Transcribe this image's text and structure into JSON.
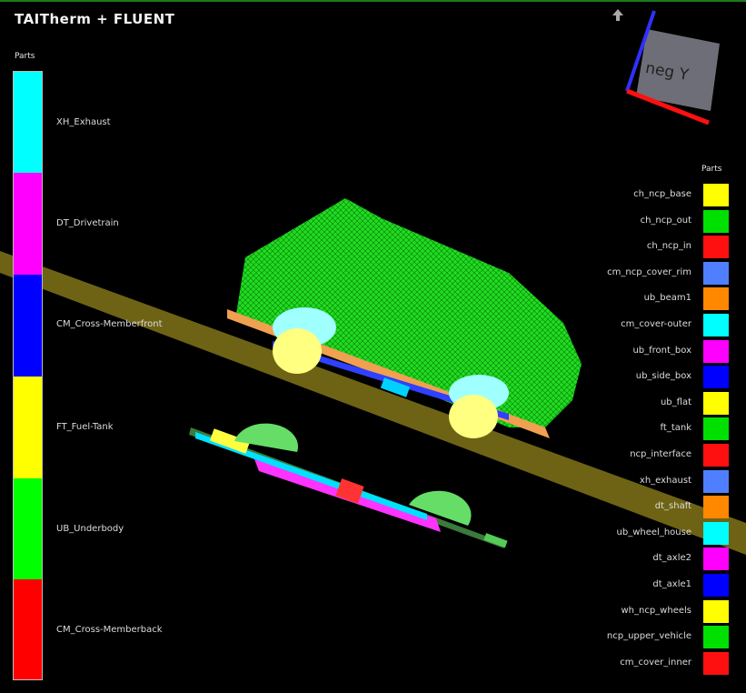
{
  "window": {
    "title": "TAITherm + FLUENT"
  },
  "left_legend": {
    "title": "Parts",
    "items": [
      {
        "label": "XH_Exhaust",
        "color": "#00ffff"
      },
      {
        "label": "DT_Drivetrain",
        "color": "#ff00ff"
      },
      {
        "label": "CM_Cross-Memberfront",
        "color": "#0000ff"
      },
      {
        "label": "FT_Fuel-Tank",
        "color": "#ffff00"
      },
      {
        "label": "UB_Underbody",
        "color": "#00ff00"
      },
      {
        "label": "CM_Cross-Memberback",
        "color": "#ff0000"
      }
    ]
  },
  "right_legend": {
    "title": "Parts",
    "items": [
      {
        "label": "ch_ncp_base",
        "color": "#ffff00"
      },
      {
        "label": "ch_ncp_out",
        "color": "#00e000"
      },
      {
        "label": "ch_ncp_in",
        "color": "#ff1010"
      },
      {
        "label": "cm_ncp_cover_rim",
        "color": "#4f7fff"
      },
      {
        "label": "ub_beam1",
        "color": "#ff8800"
      },
      {
        "label": "cm_cover-outer",
        "color": "#00ffff"
      },
      {
        "label": "ub_front_box",
        "color": "#ff00ff"
      },
      {
        "label": "ub_side_box",
        "color": "#0000ff"
      },
      {
        "label": "ub_flat",
        "color": "#ffff00"
      },
      {
        "label": "ft_tank",
        "color": "#00e000"
      },
      {
        "label": "ncp_interface",
        "color": "#ff1010"
      },
      {
        "label": "xh_exhaust",
        "color": "#4f7fff"
      },
      {
        "label": "dt_shaft",
        "color": "#ff8800"
      },
      {
        "label": "ub_wheel_house",
        "color": "#00ffff"
      },
      {
        "label": "dt_axle2",
        "color": "#ff00ff"
      },
      {
        "label": "dt_axle1",
        "color": "#0000ff"
      },
      {
        "label": "wh_ncp_wheels",
        "color": "#ffff00"
      },
      {
        "label": "ncp_upper_vehicle",
        "color": "#00e000"
      },
      {
        "label": "cm_cover_inner",
        "color": "#ff1010"
      }
    ]
  },
  "orientation_cube": {
    "face_label": "neg Y"
  }
}
